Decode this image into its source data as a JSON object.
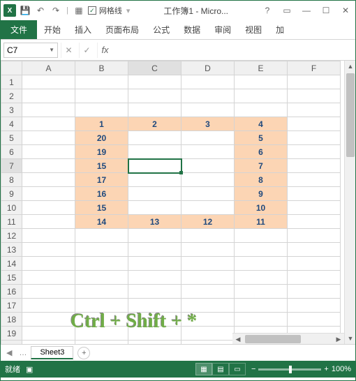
{
  "titlebar": {
    "gridlines_label": "网格线",
    "doc_title": "工作簿1 - Micro..."
  },
  "ribbon": {
    "file": "文件",
    "tabs": [
      "开始",
      "插入",
      "页面布局",
      "公式",
      "数据",
      "审阅",
      "视图",
      "加"
    ]
  },
  "namebox": {
    "value": "C7"
  },
  "columns": [
    "A",
    "B",
    "C",
    "D",
    "E",
    "F"
  ],
  "rows_visible": 21,
  "active_cell": {
    "row": 7,
    "col": "C"
  },
  "cells": {
    "B4": "1",
    "C4": "2",
    "D4": "3",
    "E4": "4",
    "B5": "20",
    "E5": "5",
    "B6": "19",
    "E6": "6",
    "B7": "15",
    "E7": "7",
    "B8": "17",
    "E8": "8",
    "B9": "16",
    "E9": "9",
    "B10": "15",
    "E10": "10",
    "B11": "14",
    "C11": "13",
    "D11": "12",
    "E11": "11"
  },
  "filled_cells": [
    "B4",
    "C4",
    "D4",
    "E4",
    "B5",
    "E5",
    "B6",
    "E6",
    "B7",
    "E7",
    "B8",
    "E8",
    "B9",
    "E9",
    "B10",
    "E10",
    "B11",
    "C11",
    "D11",
    "E11"
  ],
  "overlay_text": "Ctrl + Shift + *",
  "sheet_tabs": {
    "active": "Sheet3"
  },
  "statusbar": {
    "ready": "就绪",
    "zoom": "100%"
  }
}
